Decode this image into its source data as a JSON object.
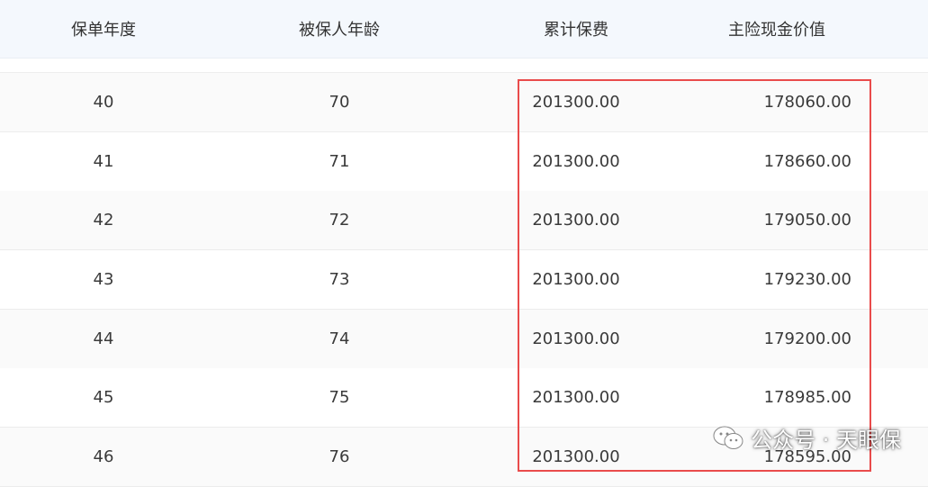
{
  "header": {
    "columns": [
      "保单年度",
      "被保人年龄",
      "累计保费",
      "主险现金价值"
    ]
  },
  "rows": [
    {
      "year": "40",
      "age": "70",
      "premium": "201300.00",
      "cash_value": "178060.00"
    },
    {
      "year": "41",
      "age": "71",
      "premium": "201300.00",
      "cash_value": "178660.00"
    },
    {
      "year": "42",
      "age": "72",
      "premium": "201300.00",
      "cash_value": "179050.00"
    },
    {
      "year": "43",
      "age": "73",
      "premium": "201300.00",
      "cash_value": "179230.00"
    },
    {
      "year": "44",
      "age": "74",
      "premium": "201300.00",
      "cash_value": "179200.00"
    },
    {
      "year": "45",
      "age": "75",
      "premium": "201300.00",
      "cash_value": "178985.00"
    },
    {
      "year": "46",
      "age": "76",
      "premium": "201300.00",
      "cash_value": "178595.00"
    }
  ],
  "watermark": {
    "text": "公众号 · 天眼保",
    "icon": "wechat-icon"
  },
  "colors": {
    "header_bg": "#f4f8fd",
    "highlight_border": "#e94b4b",
    "row_alt_bg": "#fafafa"
  }
}
